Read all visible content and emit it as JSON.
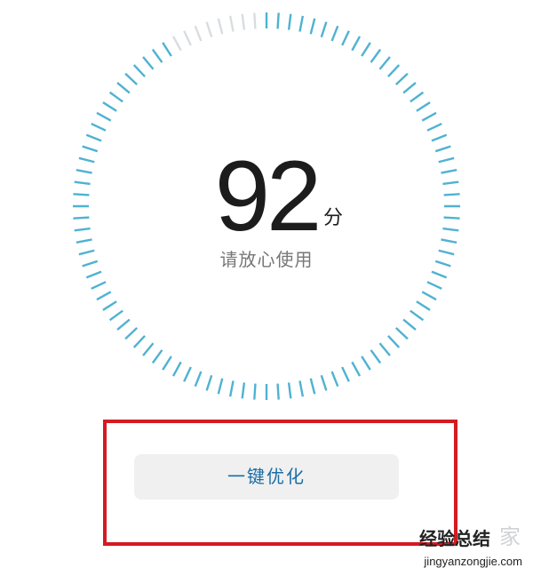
{
  "gauge": {
    "score": "92",
    "unit": "分",
    "status": "请放心使用",
    "fill_fraction": 0.92,
    "active_color": "#4fb2d2",
    "inactive_color": "#d9dddf"
  },
  "action": {
    "optimize_label": "一键优化",
    "label_color": "#1b6ea6",
    "highlight_color": "#d41b21"
  },
  "watermark": {
    "title": "经验总结",
    "suffix": "家",
    "url": "jingyanzongjie.com"
  }
}
